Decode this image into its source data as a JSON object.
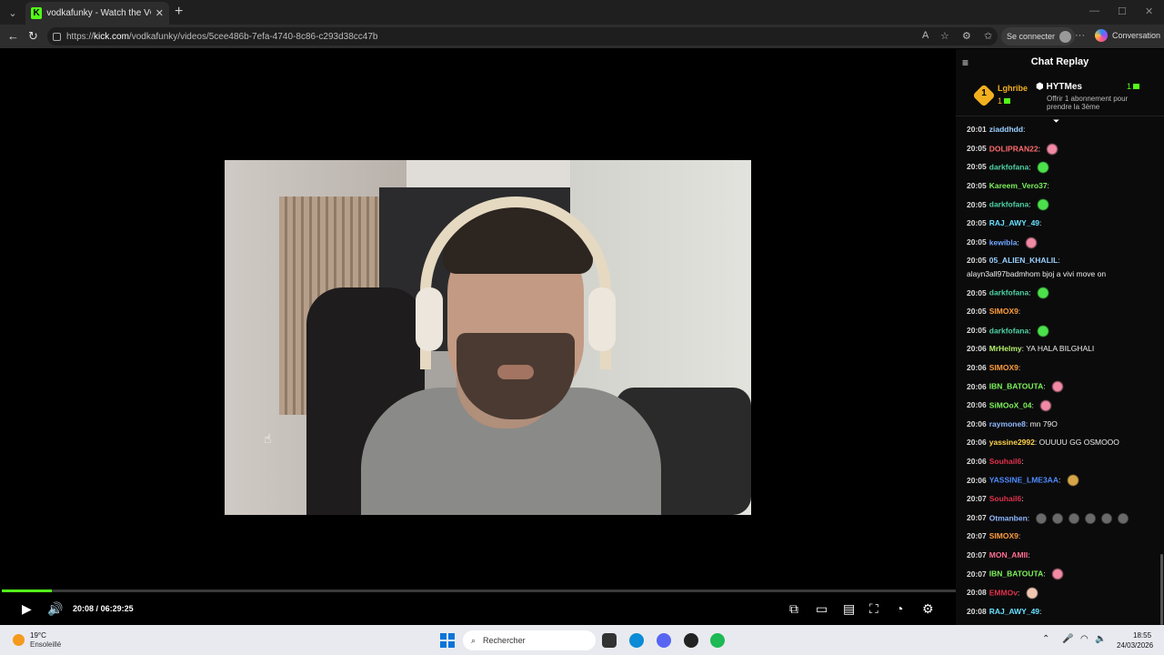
{
  "browser": {
    "tab_title": "vodkafunky - Watch the VOD on K",
    "url_prefix": "https://",
    "url_domain": "kick.com",
    "url_path": "/vodkafunky/videos/5cee486b-7efa-4740-8c86-c293d38cc47b",
    "signin_label": "Se connecter",
    "conversation_label": "Conversation"
  },
  "player": {
    "current_time": "20:08",
    "separator": "/",
    "duration": "06:29:25",
    "progress_fraction": 0.052,
    "accent_color": "#53fc18"
  },
  "chat": {
    "title": "Chat Replay",
    "top_gifter": {
      "rank": "1",
      "name": "Lghribe",
      "count": "1"
    },
    "second_gifter": {
      "name": "HYTMes",
      "count": "1"
    },
    "gift_note": "Offrir 1 abonnement pour prendre la 3ème",
    "messages": [
      {
        "ts": "20:01",
        "user": "ziaddhdd",
        "color": "#9ad1ff",
        "text": "",
        "emotes": [
          "face"
        ]
      },
      {
        "ts": "20:05",
        "user": "DOLIPRAN22",
        "color": "#ff6b6b",
        "text": "",
        "emotes": [
          "pink"
        ]
      },
      {
        "ts": "20:05",
        "user": "darkfofana",
        "color": "#4fd2a4",
        "text": "",
        "emotes": [
          "green"
        ]
      },
      {
        "ts": "20:05",
        "user": "Kareem_Vero37",
        "color": "#7cf25a",
        "text": "",
        "emotes": [
          "face"
        ]
      },
      {
        "ts": "20:05",
        "user": "darkfofana",
        "color": "#4fd2a4",
        "text": "",
        "emotes": [
          "green"
        ]
      },
      {
        "ts": "20:05",
        "user": "RAJ_AWY_49",
        "color": "#66e0ff",
        "text": "",
        "emotes": [
          "face"
        ]
      },
      {
        "ts": "20:05",
        "user": "kewibla",
        "color": "#6fa8ff",
        "text": "",
        "emotes": [
          "pink"
        ]
      },
      {
        "ts": "20:05",
        "user": "05_ALIEN_KHALIL",
        "color": "#9ad1ff",
        "text": "",
        "emotes": []
      },
      {
        "ts": "",
        "user": "",
        "color": "#eee",
        "text": "alayn3all97badmhom bjoj a vivi move on",
        "emotes": []
      },
      {
        "ts": "20:05",
        "user": "darkfofana",
        "color": "#4fd2a4",
        "text": "",
        "emotes": [
          "green"
        ]
      },
      {
        "ts": "20:05",
        "user": "SIMOX9",
        "color": "#ff9d3c",
        "text": "",
        "emotes": [
          "face"
        ]
      },
      {
        "ts": "20:05",
        "user": "darkfofana",
        "color": "#4fd2a4",
        "text": "",
        "emotes": [
          "green"
        ]
      },
      {
        "ts": "20:06",
        "user": "MrHelmy",
        "color": "#b7f36b",
        "text": "YA HALA BILGHALI",
        "emotes": []
      },
      {
        "ts": "20:06",
        "user": "SIMOX9",
        "color": "#ff9d3c",
        "text": "",
        "emotes": [
          "face"
        ]
      },
      {
        "ts": "20:06",
        "user": "IBN_BATOUTA",
        "color": "#7cf25a",
        "text": "",
        "emotes": [
          "pink"
        ]
      },
      {
        "ts": "20:06",
        "user": "SiMOoX_04",
        "color": "#7cf25a",
        "text": "",
        "emotes": [
          "pink"
        ]
      },
      {
        "ts": "20:06",
        "user": "raymone8",
        "color": "#8fb8ff",
        "text": "mn 79O",
        "emotes": []
      },
      {
        "ts": "20:06",
        "user": "yassine2992",
        "color": "#ffd34d",
        "text": "OUUUU GG OSMOOO",
        "emotes": []
      },
      {
        "ts": "20:06",
        "user": "Souhail6",
        "color": "#e0304a",
        "text": "",
        "emotes": [
          "face"
        ]
      },
      {
        "ts": "20:06",
        "user": "YASSINE_LME3AA",
        "color": "#4f8cff",
        "text": "",
        "emotes": [
          "cookie"
        ]
      },
      {
        "ts": "20:07",
        "user": "Souhail6",
        "color": "#e0304a",
        "text": "",
        "emotes": [
          "face"
        ]
      },
      {
        "ts": "20:07",
        "user": "Otmanben",
        "color": "#8fb8ff",
        "text": "",
        "emotes": [
          "gosub",
          "gosub",
          "gosub",
          "gosub",
          "gosub",
          "gosub"
        ]
      },
      {
        "ts": "20:07",
        "user": "SIMOX9",
        "color": "#ff9d3c",
        "text": "",
        "emotes": [
          "face"
        ]
      },
      {
        "ts": "20:07",
        "user": "MON_AMII",
        "color": "#ff6f91",
        "text": "",
        "emotes": [
          "face"
        ]
      },
      {
        "ts": "20:07",
        "user": "IBN_BATOUTA",
        "color": "#7cf25a",
        "text": "",
        "emotes": [
          "pink"
        ]
      },
      {
        "ts": "20:08",
        "user": "EMMOv",
        "color": "#e0304a",
        "text": "",
        "emotes": [
          "baby"
        ]
      },
      {
        "ts": "20:08",
        "user": "RAJ_AWY_49",
        "color": "#66e0ff",
        "text": "",
        "emotes": [
          "face"
        ]
      }
    ]
  },
  "taskbar": {
    "weather_temp": "19°C",
    "weather_desc": "Ensoleillé",
    "search_placeholder": "Rechercher",
    "time": "18:55",
    "date": "24/03/2026"
  }
}
